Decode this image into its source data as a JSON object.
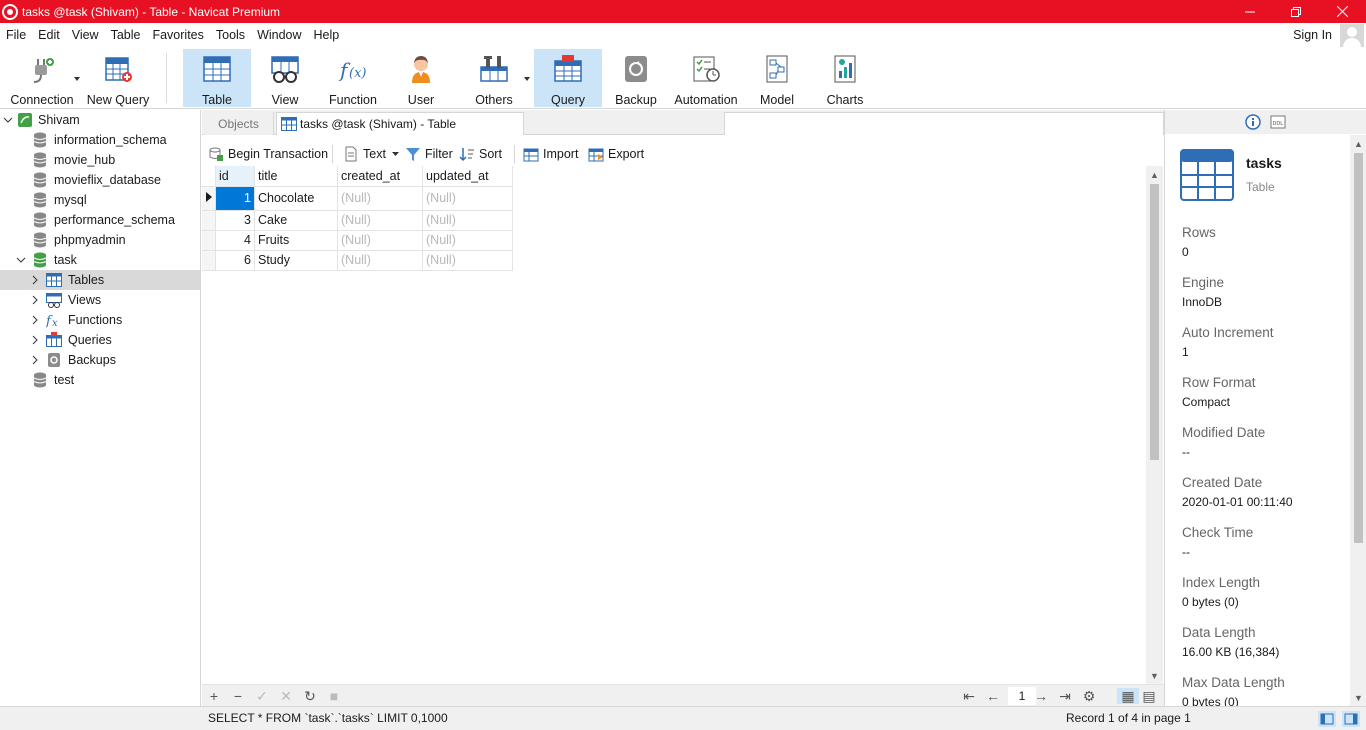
{
  "window": {
    "title": "tasks @task (Shivam) - Table - Navicat Premium",
    "controls": [
      "minimize",
      "restore",
      "close"
    ]
  },
  "menu": [
    "File",
    "Edit",
    "View",
    "Table",
    "Favorites",
    "Tools",
    "Window",
    "Help"
  ],
  "account": {
    "sign_in": "Sign In"
  },
  "toolbar": {
    "connection": "Connection",
    "new_query": "New Query",
    "table": "Table",
    "view": "View",
    "function": "Function",
    "user": "User",
    "others": "Others",
    "query": "Query",
    "backup": "Backup",
    "automation": "Automation",
    "model": "Model",
    "charts": "Charts"
  },
  "tree": {
    "connection": "Shivam",
    "databases": [
      "information_schema",
      "movie_hub",
      "movieflix_database",
      "mysql",
      "performance_schema",
      "phpmyadmin",
      "task"
    ],
    "task_children": [
      "Tables",
      "Views",
      "Functions",
      "Queries",
      "Backups"
    ],
    "last_db": "test"
  },
  "tabs": {
    "objects": "Objects",
    "current": "tasks @task (Shivam) - Table"
  },
  "subtoolbar": {
    "begin_transaction": "Begin Transaction",
    "text": "Text",
    "filter": "Filter",
    "sort": "Sort",
    "import": "Import",
    "export": "Export"
  },
  "grid": {
    "columns": [
      "id",
      "title",
      "created_at",
      "updated_at"
    ],
    "rows": [
      [
        "1",
        "Chocolate",
        "(Null)",
        "(Null)"
      ],
      [
        "3",
        "Cake",
        "(Null)",
        "(Null)"
      ],
      [
        "4",
        "Fruits",
        "(Null)",
        "(Null)"
      ],
      [
        "6",
        "Study",
        "(Null)",
        "(Null)"
      ]
    ]
  },
  "pager": {
    "page": "1"
  },
  "status": {
    "sql": "SELECT * FROM `task`.`tasks` LIMIT 0,1000",
    "record": "Record 1 of 4 in page 1"
  },
  "info_panel": {
    "name": "tasks",
    "kind": "Table",
    "properties": [
      {
        "label": "Rows",
        "value": "0"
      },
      {
        "label": "Engine",
        "value": "InnoDB"
      },
      {
        "label": "Auto Increment",
        "value": "1"
      },
      {
        "label": "Row Format",
        "value": "Compact"
      },
      {
        "label": "Modified Date",
        "value": "--"
      },
      {
        "label": "Created Date",
        "value": "2020-01-01 00:11:40"
      },
      {
        "label": "Check Time",
        "value": "--"
      },
      {
        "label": "Index Length",
        "value": "0 bytes (0)"
      },
      {
        "label": "Data Length",
        "value": "16.00 KB (16,384)"
      },
      {
        "label": "Max Data Length",
        "value": "0 bytes (0)"
      }
    ]
  },
  "colors": {
    "titlebar": "#e81123",
    "active_toolbar": "#cce4f7",
    "selection": "#0078d7",
    "icon_blue": "#2f6db5"
  }
}
